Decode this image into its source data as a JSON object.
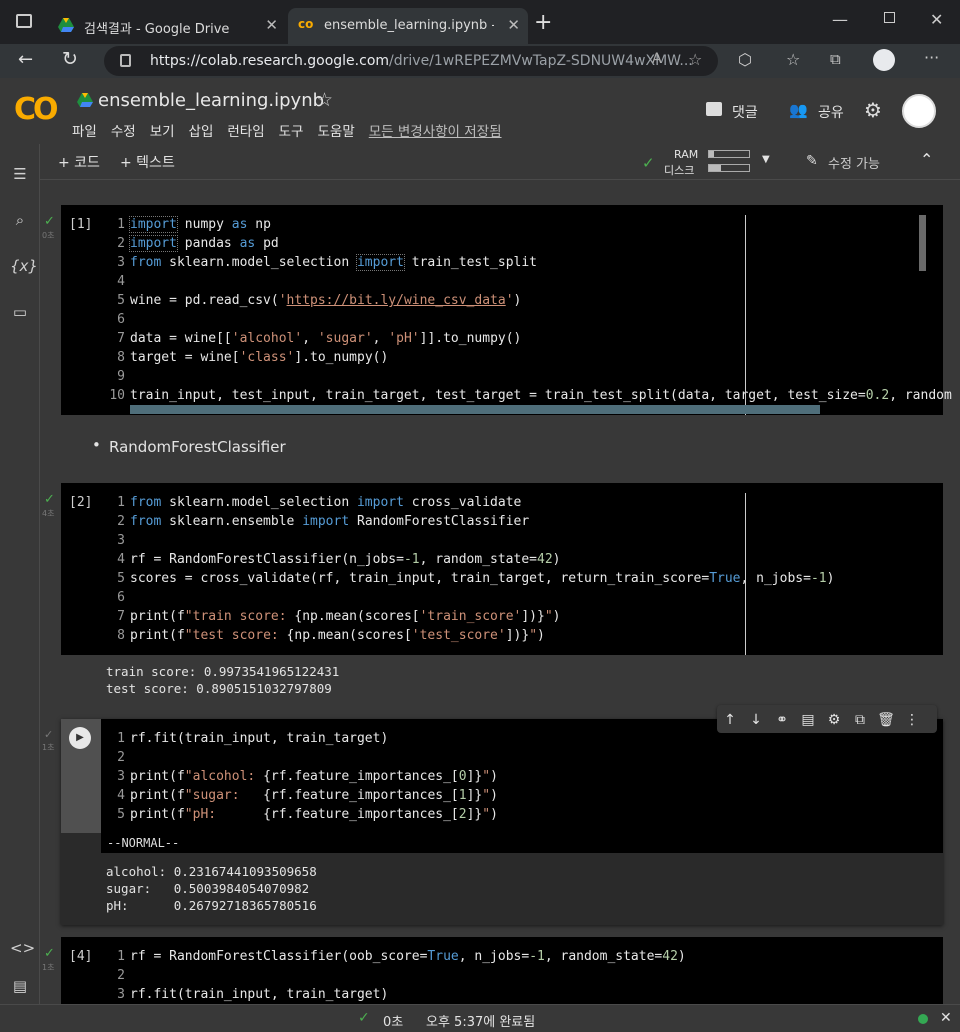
{
  "browser": {
    "tabs": [
      {
        "title": "검색결과 - Google Drive",
        "active": false
      },
      {
        "title": "ensemble_learning.ipynb - Colab",
        "active": true
      }
    ],
    "url_host": "https://colab.research.google.com",
    "url_path": "/drive/1wREPEZMVwTapZ-SDNUW4wXMW..."
  },
  "colab": {
    "logo": "CO",
    "filename": "ensemble_learning.ipynb",
    "menu": [
      "파일",
      "수정",
      "보기",
      "삽입",
      "런타임",
      "도구",
      "도움말"
    ],
    "save_status": "모든 변경사항이 저장됨",
    "comment_label": "댓글",
    "share_label": "공유"
  },
  "toolbar": {
    "add_code": "+ 코드",
    "add_text": "+ 텍스트",
    "ram_label": "RAM",
    "disk_label": "디스크",
    "ram_fill": 0.12,
    "disk_fill": 0.3,
    "edit_label": "수정 가능"
  },
  "cells": {
    "c1": {
      "num": "[1]",
      "time": "0초",
      "lines": [
        "import numpy as np",
        "import pandas as pd",
        "from sklearn.model_selection import train_test_split",
        "",
        "wine = pd.read_csv('https://bit.ly/wine_csv_data')",
        "",
        "data = wine[['alcohol', 'sugar', 'pH']].to_numpy()",
        "target = wine['class'].to_numpy()",
        "",
        "train_input, test_input, train_target, test_target = train_test_split(data, target, test_size=0.2, random"
      ]
    },
    "text1": "RandomForestClassifier",
    "c2": {
      "num": "[2]",
      "time": "4초",
      "output": [
        "train score: 0.9973541965122431",
        "test score: 0.8905151032797809"
      ]
    },
    "c3": {
      "time": "1초",
      "mode": "--NORMAL--",
      "output": [
        "alcohol: 0.23167441093509658",
        "sugar:   0.5003984054070982",
        "pH:      0.26792718365780516"
      ]
    },
    "c4": {
      "num": "[4]",
      "time": "1초"
    }
  },
  "status": {
    "elapsed": "0초",
    "completed": "오후 5:37에 완료됨"
  },
  "colors": {
    "accent": "#f9ab00",
    "ok": "#4caf50",
    "bg": "#383838"
  }
}
